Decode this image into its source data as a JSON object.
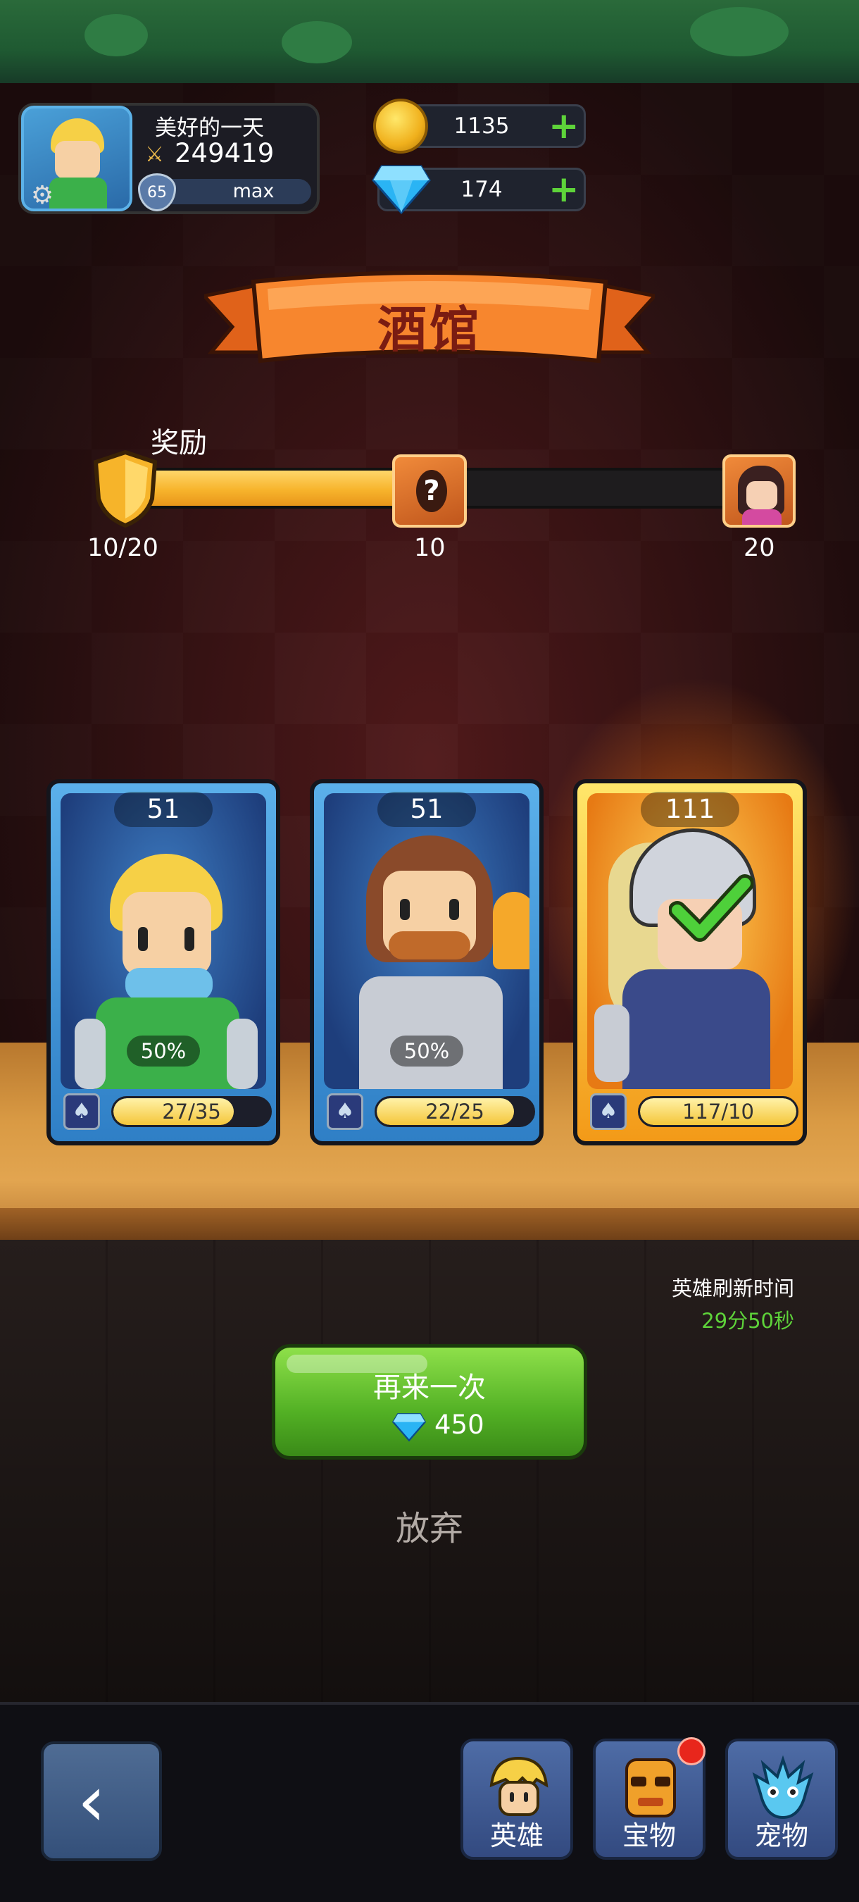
{
  "header": {
    "player_name": "美好的一天",
    "power": "249419",
    "level": "65",
    "level_status": "max",
    "gold": "1135",
    "gems": "174"
  },
  "banner": {
    "title": "酒馆"
  },
  "reward": {
    "label": "奖励",
    "progress_text": "10/20",
    "current": 10,
    "max": 20,
    "milestones": [
      "10",
      "20"
    ]
  },
  "cards": [
    {
      "power": "51",
      "percent": "50%",
      "shards": "27/35",
      "shard_fraction": 0.77,
      "rarity": "blue",
      "selected": false
    },
    {
      "power": "51",
      "percent": "50%",
      "shards": "22/25",
      "shard_fraction": 0.88,
      "rarity": "blue",
      "selected": false
    },
    {
      "power": "111",
      "percent": "",
      "shards": "117/10",
      "shard_fraction": 1.0,
      "rarity": "gold",
      "selected": true
    }
  ],
  "refresh": {
    "label": "英雄刷新时间",
    "time": "29分50秒"
  },
  "again_button": {
    "label": "再来一次",
    "cost": "450"
  },
  "giveup_label": "放弃",
  "nav": {
    "heroes": "英雄",
    "treasure": "宝物",
    "pets": "宠物"
  },
  "colors": {
    "accent_green": "#5ed33a",
    "banner_orange": "#f07a2a",
    "card_blue": "#3f8fd6",
    "card_gold": "#f7b42c"
  }
}
